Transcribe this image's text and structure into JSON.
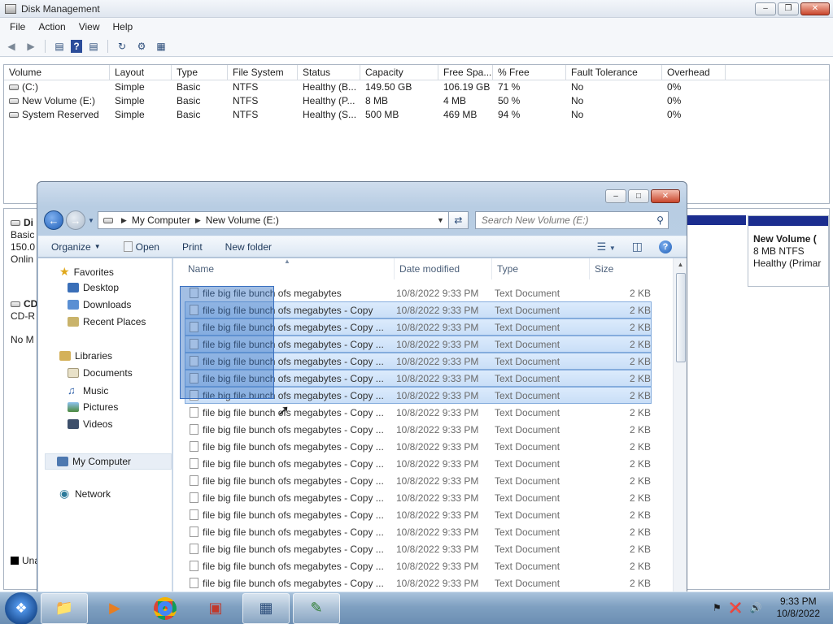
{
  "disk_mgmt": {
    "title": "Disk Management",
    "menu": [
      "File",
      "Action",
      "View",
      "Help"
    ],
    "columns": [
      "Volume",
      "Layout",
      "Type",
      "File System",
      "Status",
      "Capacity",
      "Free Spa...",
      "% Free",
      "Fault Tolerance",
      "Overhead"
    ],
    "volumes": [
      [
        "(C:)",
        "Simple",
        "Basic",
        "NTFS",
        "Healthy (B...",
        "149.50 GB",
        "106.19 GB",
        "71 %",
        "No",
        "0%"
      ],
      [
        "New Volume (E:)",
        "Simple",
        "Basic",
        "NTFS",
        "Healthy (P...",
        "8 MB",
        "4 MB",
        "50 %",
        "No",
        "0%"
      ],
      [
        "System Reserved",
        "Simple",
        "Basic",
        "NTFS",
        "Healthy (S...",
        "500 MB",
        "469 MB",
        "94 %",
        "No",
        "0%"
      ]
    ],
    "disk0": {
      "name": "Di",
      "type": "Basic",
      "size": "150.0",
      "state": "Onlin"
    },
    "cdrom": {
      "name": "CD",
      "type": "CD-R",
      "media": "No M"
    },
    "vol_e_box": {
      "name": "New Volume (",
      "fs": "8 MB NTFS",
      "status": "Healthy (Primar"
    },
    "legend_unalloc": "Una"
  },
  "explorer": {
    "breadcrumb": [
      "My Computer",
      "New Volume (E:)"
    ],
    "search_placeholder": "Search New Volume (E:)",
    "commands": {
      "organize": "Organize",
      "open": "Open",
      "print": "Print",
      "new_folder": "New folder"
    },
    "nav": {
      "favorites": "Favorites",
      "desktop": "Desktop",
      "downloads": "Downloads",
      "recent": "Recent Places",
      "libraries": "Libraries",
      "documents": "Documents",
      "music": "Music",
      "pictures": "Pictures",
      "videos": "Videos",
      "computer": "My Computer",
      "network": "Network"
    },
    "headers": {
      "name": "Name",
      "date": "Date modified",
      "type": "Type",
      "size": "Size"
    },
    "files": [
      {
        "name": "file big file bunch ofs megabytes",
        "date": "10/8/2022 9:33 PM",
        "type": "Text Document",
        "size": "2 KB",
        "selected": false
      },
      {
        "name": "file big file bunch ofs megabytes - Copy",
        "date": "10/8/2022 9:33 PM",
        "type": "Text Document",
        "size": "2 KB",
        "selected": true
      },
      {
        "name": "file big file bunch ofs megabytes - Copy ...",
        "date": "10/8/2022 9:33 PM",
        "type": "Text Document",
        "size": "2 KB",
        "selected": true
      },
      {
        "name": "file big file bunch ofs megabytes - Copy ...",
        "date": "10/8/2022 9:33 PM",
        "type": "Text Document",
        "size": "2 KB",
        "selected": true
      },
      {
        "name": "file big file bunch ofs megabytes - Copy ...",
        "date": "10/8/2022 9:33 PM",
        "type": "Text Document",
        "size": "2 KB",
        "selected": true
      },
      {
        "name": "file big file bunch ofs megabytes - Copy ...",
        "date": "10/8/2022 9:33 PM",
        "type": "Text Document",
        "size": "2 KB",
        "selected": true
      },
      {
        "name": "file big file bunch ofs megabytes - Copy ...",
        "date": "10/8/2022 9:33 PM",
        "type": "Text Document",
        "size": "2 KB",
        "selected": true
      },
      {
        "name": "file big file bunch ofs megabytes - Copy ...",
        "date": "10/8/2022 9:33 PM",
        "type": "Text Document",
        "size": "2 KB",
        "selected": false
      },
      {
        "name": "file big file bunch ofs megabytes - Copy ...",
        "date": "10/8/2022 9:33 PM",
        "type": "Text Document",
        "size": "2 KB",
        "selected": false
      },
      {
        "name": "file big file bunch ofs megabytes - Copy ...",
        "date": "10/8/2022 9:33 PM",
        "type": "Text Document",
        "size": "2 KB",
        "selected": false
      },
      {
        "name": "file big file bunch ofs megabytes - Copy ...",
        "date": "10/8/2022 9:33 PM",
        "type": "Text Document",
        "size": "2 KB",
        "selected": false
      },
      {
        "name": "file big file bunch ofs megabytes - Copy ...",
        "date": "10/8/2022 9:33 PM",
        "type": "Text Document",
        "size": "2 KB",
        "selected": false
      },
      {
        "name": "file big file bunch ofs megabytes - Copy ...",
        "date": "10/8/2022 9:33 PM",
        "type": "Text Document",
        "size": "2 KB",
        "selected": false
      },
      {
        "name": "file big file bunch ofs megabytes - Copy ...",
        "date": "10/8/2022 9:33 PM",
        "type": "Text Document",
        "size": "2 KB",
        "selected": false
      },
      {
        "name": "file big file bunch ofs megabytes - Copy ...",
        "date": "10/8/2022 9:33 PM",
        "type": "Text Document",
        "size": "2 KB",
        "selected": false
      },
      {
        "name": "file big file bunch ofs megabytes - Copy ...",
        "date": "10/8/2022 9:33 PM",
        "type": "Text Document",
        "size": "2 KB",
        "selected": false
      },
      {
        "name": "file big file bunch ofs megabytes - Copy ...",
        "date": "10/8/2022 9:33 PM",
        "type": "Text Document",
        "size": "2 KB",
        "selected": false
      },
      {
        "name": "file big file bunch ofs megabytes - Copy ...",
        "date": "10/8/2022 9:33 PM",
        "type": "Text Document",
        "size": "2 KB",
        "selected": false
      }
    ]
  },
  "taskbar": {
    "time": "9:33 PM",
    "date": "10/8/2022"
  },
  "colors": {
    "selection_fill": "#c9def7",
    "selection_border": "#84acdd",
    "disk_bar": "#1b2d8f"
  },
  "icons": [
    "back-arrow-icon",
    "forward-arrow-icon",
    "refresh-icon",
    "search-icon",
    "help-icon",
    "star-icon",
    "folder-icon",
    "document-icon",
    "computer-icon",
    "network-icon",
    "windows-start-icon"
  ]
}
